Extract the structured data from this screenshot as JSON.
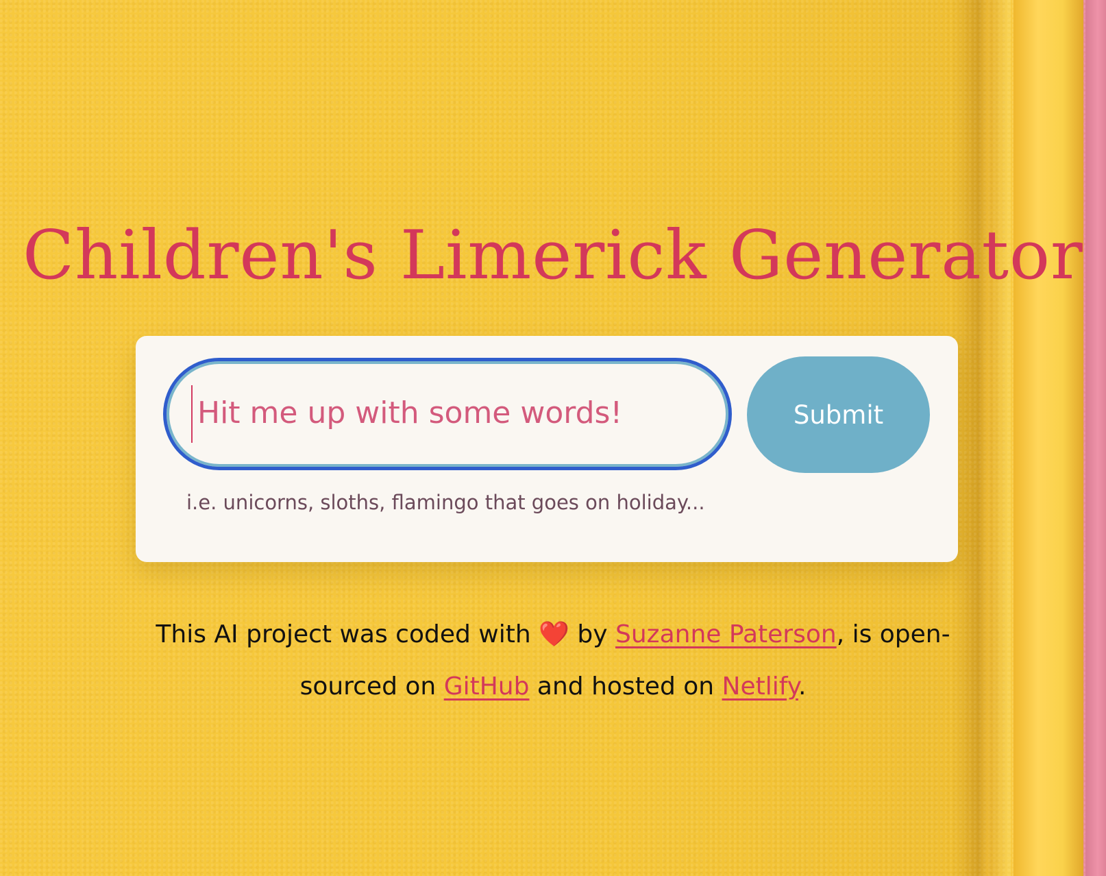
{
  "page": {
    "title": "Children's Limerick Generator"
  },
  "form": {
    "input_placeholder": "Hit me up with some words!",
    "submit_label": "Submit",
    "hint": "i.e. unicorns, sloths, flamingo that goes on holiday..."
  },
  "footer": {
    "prefix": "This AI project was coded with",
    "heart": "❤️",
    "by_text": "by",
    "author_link": "Suzanne Paterson",
    "middle_text": ", is open-sourced on",
    "github_link": "GitHub",
    "hosted_text": "and hosted on",
    "netlify_link": "Netlify",
    "suffix": "."
  },
  "colors": {
    "background": "#f7c93e",
    "title": "#d3385a",
    "card": "#faf7f2",
    "input_border": "#2f5dcc",
    "button": "#6fb0c8",
    "link": "#d3385a"
  }
}
